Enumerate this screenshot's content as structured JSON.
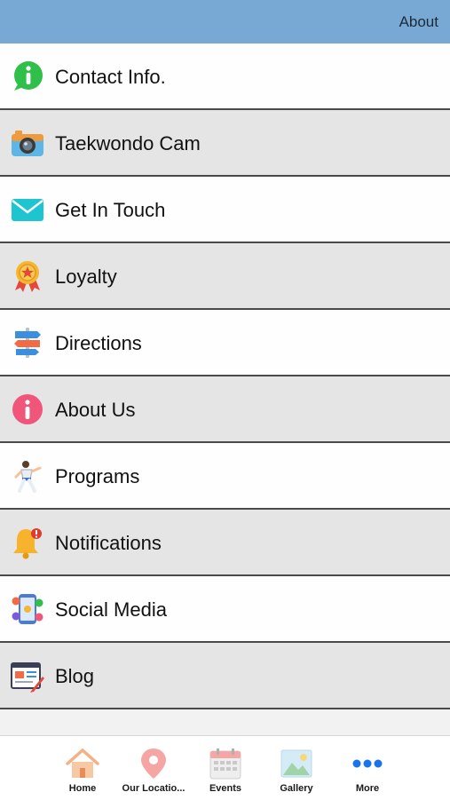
{
  "header": {
    "title": "About"
  },
  "menu": {
    "items": [
      {
        "label": "Contact Info.",
        "icon": "info-icon"
      },
      {
        "label": "Taekwondo Cam",
        "icon": "camera-icon"
      },
      {
        "label": "Get In Touch",
        "icon": "mail-icon"
      },
      {
        "label": "Loyalty",
        "icon": "medal-icon"
      },
      {
        "label": "Directions",
        "icon": "signpost-icon"
      },
      {
        "label": "About Us",
        "icon": "about-icon"
      },
      {
        "label": "Programs",
        "icon": "martial-artist-icon"
      },
      {
        "label": "Notifications",
        "icon": "bell-icon"
      },
      {
        "label": "Social Media",
        "icon": "social-phone-icon"
      },
      {
        "label": "Blog",
        "icon": "blog-icon"
      }
    ]
  },
  "tabbar": {
    "tabs": [
      {
        "label": "Home",
        "icon": "home-icon"
      },
      {
        "label": "Our Locatio...",
        "icon": "location-pin-icon"
      },
      {
        "label": "Events",
        "icon": "calendar-icon"
      },
      {
        "label": "Gallery",
        "icon": "gallery-icon"
      },
      {
        "label": "More",
        "icon": "more-dots-icon"
      }
    ]
  },
  "colors": {
    "header": "#78a9d4",
    "divider": "#4a4a4a",
    "more_dots": "#1a73e8"
  }
}
